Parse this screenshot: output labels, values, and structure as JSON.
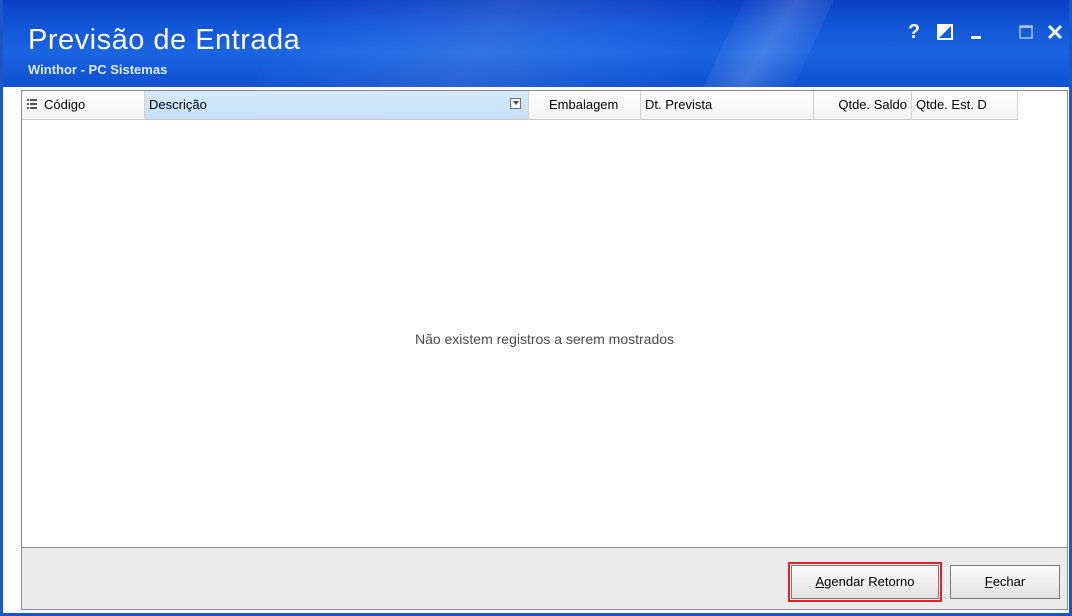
{
  "window": {
    "title": "Previsão de Entrada",
    "subtitle": "Winthor - PC Sistemas",
    "controls": {
      "help": "?",
      "mode": "◪",
      "minimize": "_",
      "maximize": "□",
      "close": "✕"
    }
  },
  "grid": {
    "columns": [
      {
        "label": "Código"
      },
      {
        "label": "Descrição"
      },
      {
        "label": "Embalagem"
      },
      {
        "label": "Dt. Prevista"
      },
      {
        "label": "Qtde. Saldo"
      },
      {
        "label": "Qtde. Est. D"
      }
    ],
    "empty_message": "Não existem registros a serem mostrados",
    "rows": []
  },
  "footer": {
    "agendar_label": "Agendar Retorno",
    "fechar_label": "Fechar"
  },
  "colors": {
    "titlebar": "#1256d8",
    "selected_column": "#c4e0f8",
    "highlight_outline": "#e0202a"
  },
  "icons": {
    "column_menu": "column-menu-icon",
    "filter": "filter-dropdown-icon"
  }
}
